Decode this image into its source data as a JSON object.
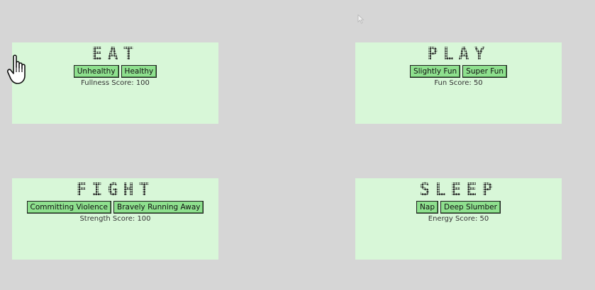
{
  "panels": {
    "eat": {
      "title": "EAT",
      "buttons": [
        "Unhealthy",
        "Healthy"
      ],
      "score": "Fullness Score: 100"
    },
    "play": {
      "title": "PLAY",
      "buttons": [
        "Slightly Fun",
        "Super Fun"
      ],
      "score": "Fun Score: 50"
    },
    "fight": {
      "title": "FIGHT",
      "buttons": [
        "Committing Violence",
        "Bravely Running Away"
      ],
      "score": "Strength Score: 100"
    },
    "sleep": {
      "title": "SLEEP",
      "buttons": [
        "Nap",
        "Deep Slumber"
      ],
      "score": "Energy Score: 50"
    }
  },
  "colors": {
    "background": "#d6d6d6",
    "panel": "#d8f7d8",
    "button": "#8ee08e"
  },
  "icons": {
    "pointer": "hand-pointer-icon",
    "arrow": "arrow-cursor-icon"
  }
}
